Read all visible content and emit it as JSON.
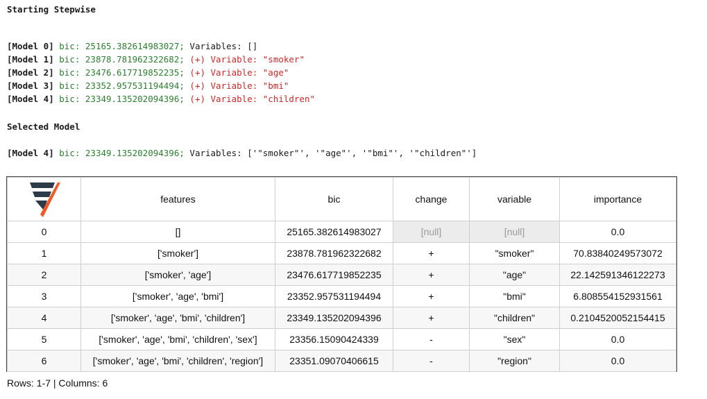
{
  "log": {
    "title": "Starting Stepwise",
    "models": [
      {
        "label": "[Model 0]",
        "bic": "bic: 25165.382614983027;",
        "change": "",
        "rest": " Variables: []"
      },
      {
        "label": "[Model 1]",
        "bic": "bic: 23878.781962322682;",
        "change": " (+) Variable: \"smoker\"",
        "rest": ""
      },
      {
        "label": "[Model 2]",
        "bic": "bic: 23476.617719852235;",
        "change": " (+) Variable: \"age\"",
        "rest": ""
      },
      {
        "label": "[Model 3]",
        "bic": "bic: 23352.957531194494;",
        "change": " (+) Variable: \"bmi\"",
        "rest": ""
      },
      {
        "label": "[Model 4]",
        "bic": "bic: 23349.135202094396;",
        "change": " (+) Variable: \"children\"",
        "rest": ""
      }
    ],
    "selected_title": "Selected Model",
    "selected": {
      "label": "[Model 4]",
      "bic": "bic: 23349.135202094396;",
      "rest": " Variables: ['\"smoker\"', '\"age\"', '\"bmi\"', '\"children\"']"
    }
  },
  "table": {
    "logo_icon": "vaex-logo-icon",
    "headers": [
      "features",
      "bic",
      "change",
      "variable",
      "importance"
    ],
    "rows": [
      {
        "index": "0",
        "features": "[]",
        "bic": "25165.382614983027",
        "change": "[null]",
        "variable": "[null]",
        "importance": "0.0"
      },
      {
        "index": "1",
        "features": "['smoker']",
        "bic": "23878.781962322682",
        "change": "+",
        "variable": "\"smoker\"",
        "importance": "70.83840249573072"
      },
      {
        "index": "2",
        "features": "['smoker', 'age']",
        "bic": "23476.617719852235",
        "change": "+",
        "variable": "\"age\"",
        "importance": "22.142591346122273"
      },
      {
        "index": "3",
        "features": "['smoker', 'age', 'bmi']",
        "bic": "23352.957531194494",
        "change": "+",
        "variable": "\"bmi\"",
        "importance": "6.808554152931561"
      },
      {
        "index": "4",
        "features": "['smoker', 'age', 'bmi', 'children']",
        "bic": "23349.135202094396",
        "change": "+",
        "variable": "\"children\"",
        "importance": "0.2104520052154415"
      },
      {
        "index": "5",
        "features": "['smoker', 'age', 'bmi', 'children', 'sex']",
        "bic": "23356.15090424339",
        "change": "-",
        "variable": "\"sex\"",
        "importance": "0.0"
      },
      {
        "index": "6",
        "features": "['smoker', 'age', 'bmi', 'children', 'region']",
        "bic": "23351.09070406615",
        "change": "-",
        "variable": "\"region\"",
        "importance": "0.0"
      }
    ],
    "footer": "Rows: 1-7 | Columns: 6"
  }
}
